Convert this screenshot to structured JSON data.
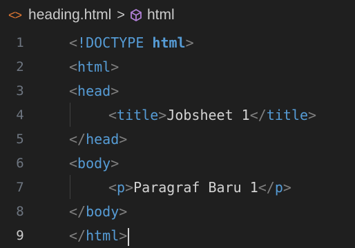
{
  "breadcrumb": {
    "file_icon": "<>",
    "file_name": "heading.html",
    "separator": ">",
    "symbol_icon": "cube-icon",
    "symbol_name": "html"
  },
  "lines": [
    {
      "number": "1",
      "open": "<",
      "doctype": "!DOCTYPE",
      "kw": "html",
      "close": ">"
    },
    {
      "number": "2",
      "open": "<",
      "tag": "html",
      "close": ">"
    },
    {
      "number": "3",
      "open": "<",
      "tag": "head",
      "close": ">"
    },
    {
      "number": "4",
      "open": "<",
      "tag": "title",
      "close": ">",
      "text": "Jobsheet 1",
      "open2": "</",
      "tag2": "title",
      "close2": ">"
    },
    {
      "number": "5",
      "open": "</",
      "tag": "head",
      "close": ">"
    },
    {
      "number": "6",
      "open": "<",
      "tag": "body",
      "close": ">"
    },
    {
      "number": "7",
      "open": "<",
      "tag": "p",
      "close": ">",
      "text": "Paragraf Baru 1",
      "open2": "</",
      "tag2": "p",
      "close2": ">"
    },
    {
      "number": "8",
      "open": "</",
      "tag": "body",
      "close": ">"
    },
    {
      "number": "9",
      "open": "</",
      "tag": "html",
      "close": ">"
    }
  ],
  "active_line": "9"
}
